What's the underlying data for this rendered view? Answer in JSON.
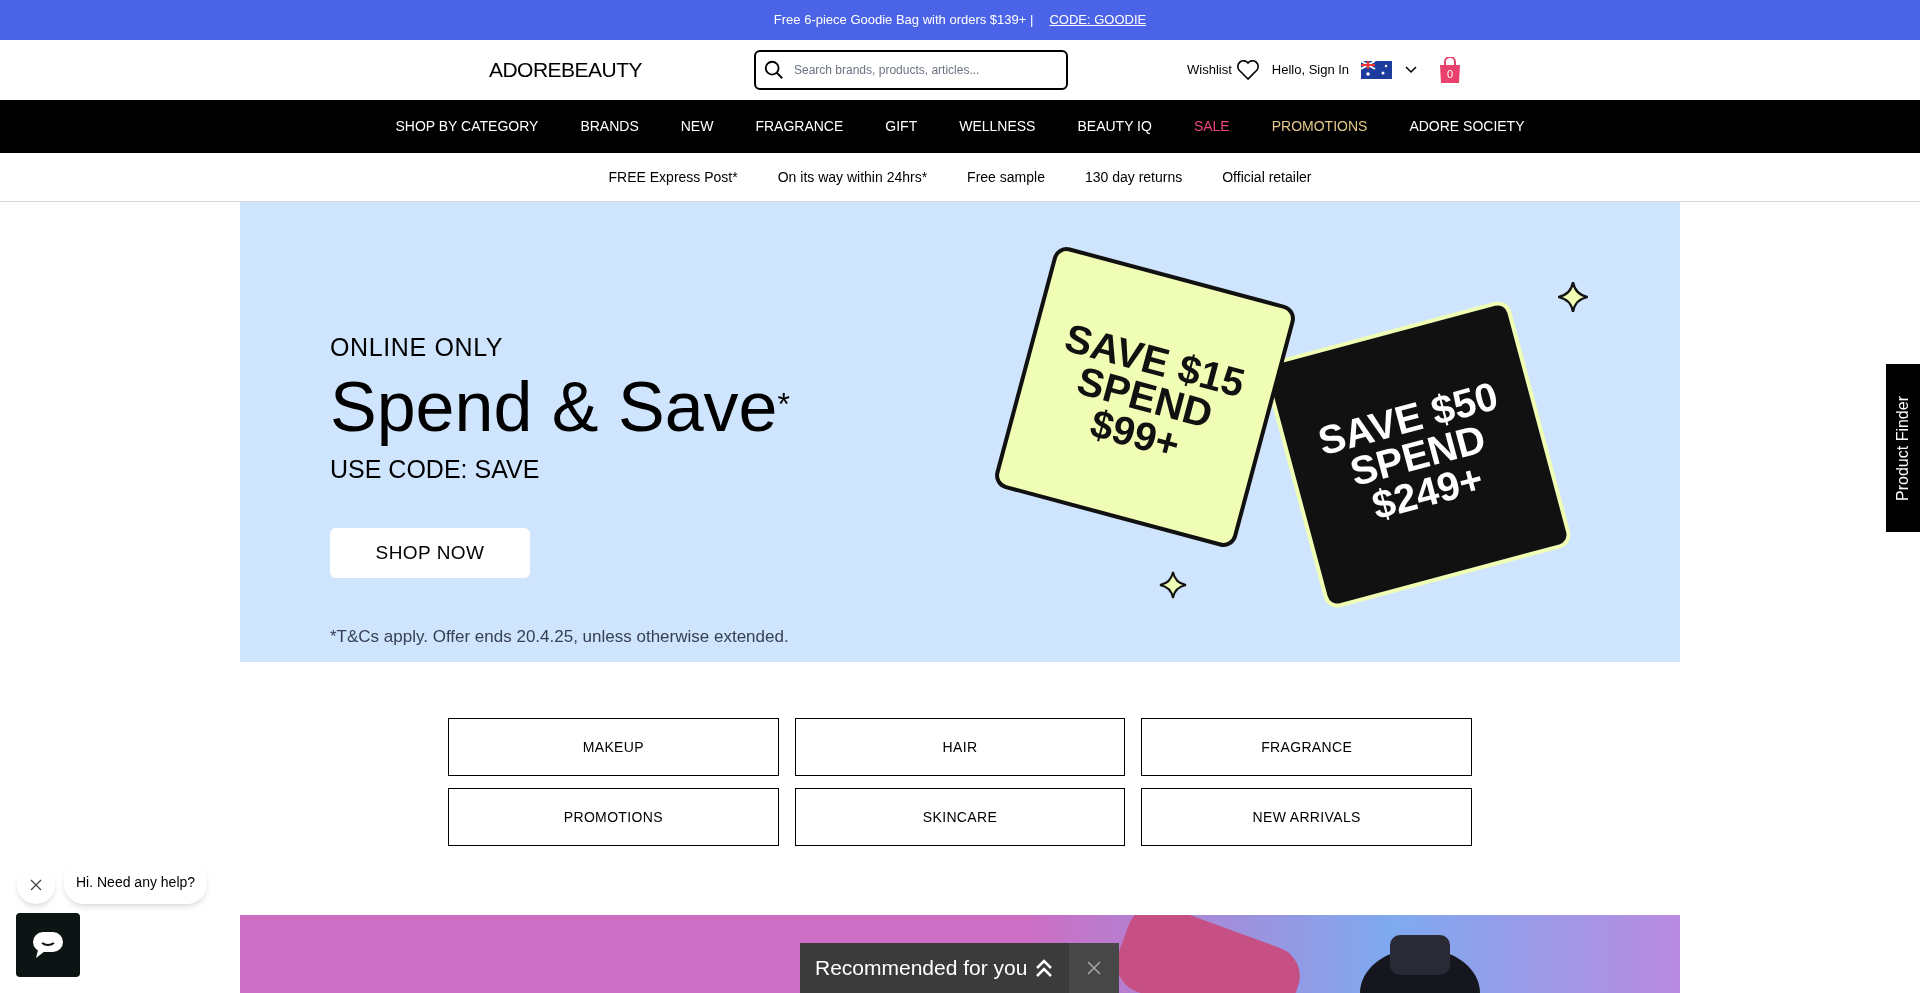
{
  "promo_bar": {
    "text": "Free 6-piece Goodie Bag with orders $139+ |",
    "link": "CODE: GOODIE"
  },
  "header": {
    "logo": "ADOREBEAUTY",
    "search": {
      "placeholder": "Search brands, products, articles..."
    },
    "wishlist": "Wishlist",
    "sign_in": "Hello, Sign In",
    "cart_count": "0"
  },
  "nav": [
    {
      "label": "SHOP BY CATEGORY",
      "kind": "normal"
    },
    {
      "label": "BRANDS",
      "kind": "normal"
    },
    {
      "label": "NEW",
      "kind": "normal"
    },
    {
      "label": "FRAGRANCE",
      "kind": "normal"
    },
    {
      "label": "GIFT",
      "kind": "normal"
    },
    {
      "label": "WELLNESS",
      "kind": "normal"
    },
    {
      "label": "BEAUTY IQ",
      "kind": "normal"
    },
    {
      "label": "SALE",
      "kind": "sale"
    },
    {
      "label": "PROMOTIONS",
      "kind": "promo"
    },
    {
      "label": "ADORE SOCIETY",
      "kind": "normal"
    }
  ],
  "usps": [
    "FREE Express Post*",
    "On its way within 24hrs*",
    "Free sample",
    "130 day returns",
    "Official retailer"
  ],
  "hero": {
    "eyebrow": "ONLINE ONLY",
    "title": "Spend & Save$^{*}$",
    "code": "USE CODE: SAVE",
    "button": "SHOP NOW",
    "terms": "*T&Cs apply. Offer ends 20.4.25, unless otherwise extended.",
    "cards": [
      {
        "lines": [
          "SAVE $15",
          "SPEND",
          "$99+"
        ],
        "color": "#f0fdb4"
      },
      {
        "lines": [
          "SAVE $50",
          "SPEND",
          "$249+"
        ],
        "color": "#111111"
      }
    ]
  },
  "categories": [
    "MAKEUP",
    "HAIR",
    "FRAGRANCE",
    "PROMOTIONS",
    "SKINCARE",
    "NEW ARRIVALS"
  ],
  "product_finder": "Product Finder",
  "chat": {
    "message": "Hi. Need any help?"
  },
  "recommended": {
    "label": "Recommended for you"
  }
}
